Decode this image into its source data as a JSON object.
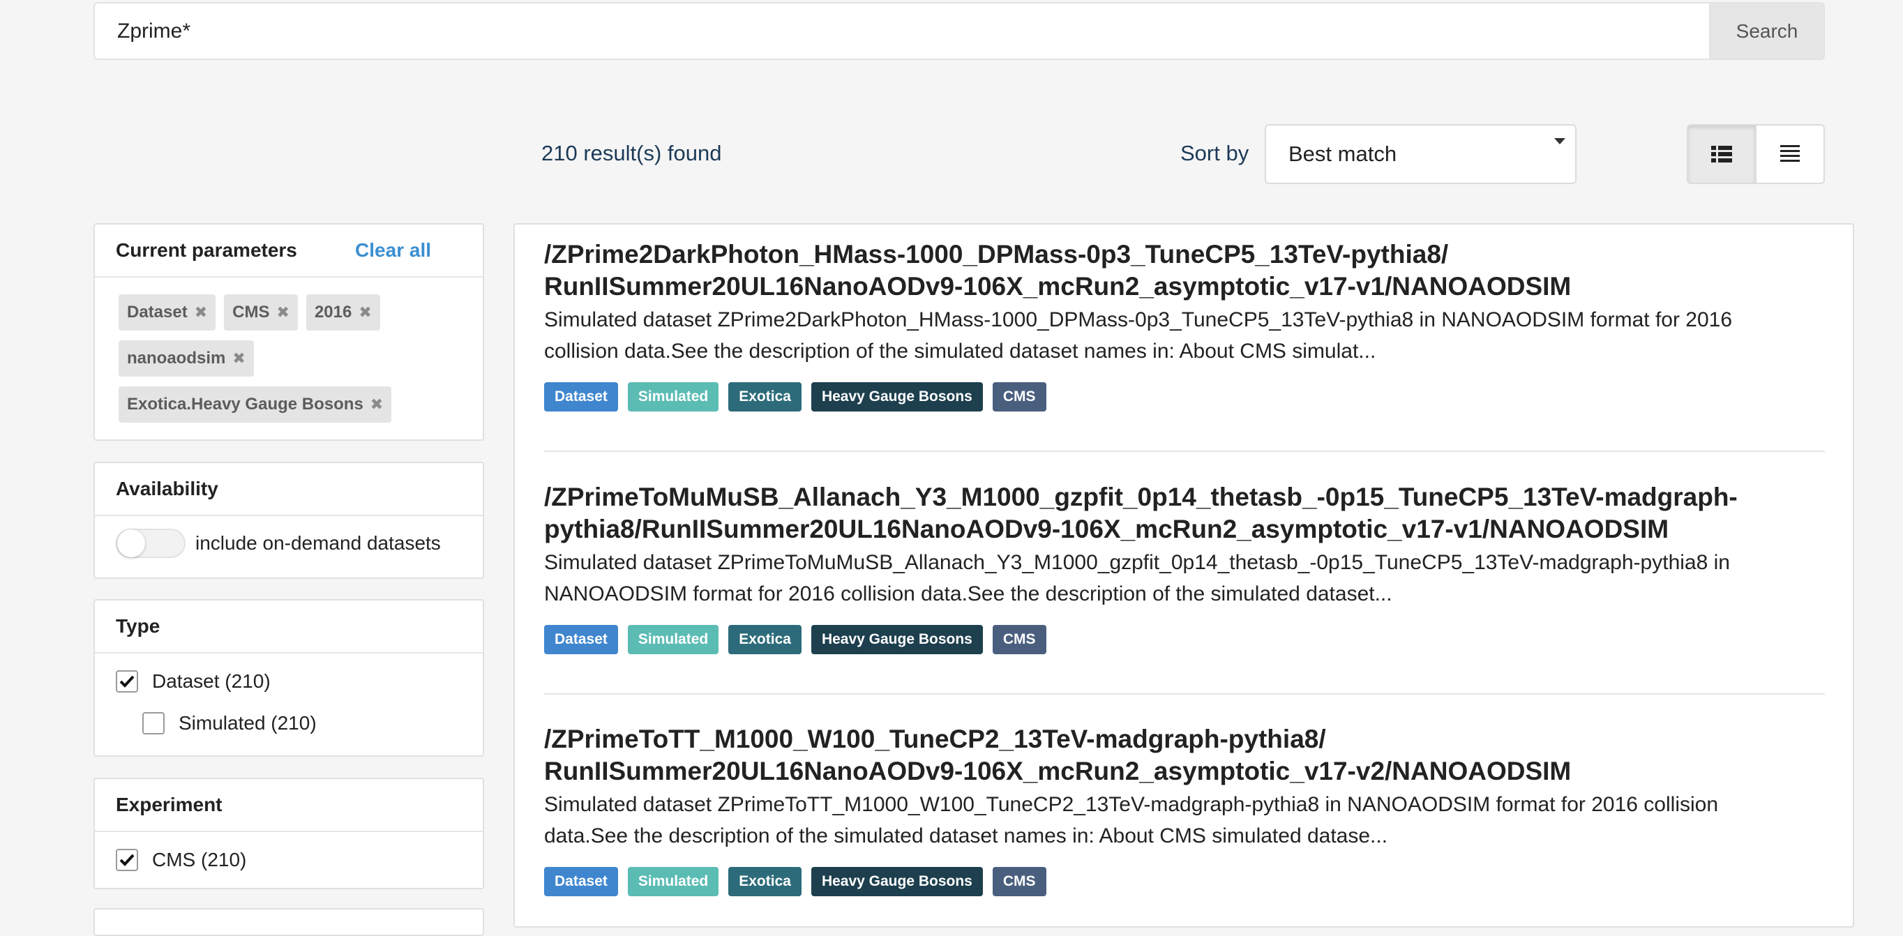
{
  "search": {
    "value": "Zprime*",
    "button_label": "Search"
  },
  "toolbar": {
    "results_count": "210 result(s) found",
    "sort_label": "Sort by",
    "sort_selected": "Best match",
    "view_icons": [
      "list-view-icon",
      "detailed-list-icon"
    ]
  },
  "sidebar": {
    "current_parameters": {
      "title": "Current parameters",
      "clear_label": "Clear all",
      "chips": [
        "Dataset",
        "CMS",
        "2016",
        "nanoaodsim",
        "Exotica.Heavy Gauge Bosons"
      ]
    },
    "availability": {
      "title": "Availability",
      "toggle_label": "include on-demand datasets",
      "toggle_on": false
    },
    "type": {
      "title": "Type",
      "options": [
        {
          "label": "Dataset (210)",
          "checked": true
        },
        {
          "label": "Simulated (210)",
          "checked": false
        }
      ]
    },
    "experiment": {
      "title": "Experiment",
      "options": [
        {
          "label": "CMS (210)",
          "checked": true
        }
      ]
    }
  },
  "results": [
    {
      "title_line1": "/ZPrime2DarkPhoton_HMass-1000_DPMass-0p3_TuneCP5_13TeV-pythia8/",
      "title_line2": "RunIISummer20UL16NanoAODv9-106X_mcRun2_asymptotic_v17-v1/NANOAODSIM",
      "desc_line1": "Simulated dataset ZPrime2DarkPhoton_HMass-1000_DPMass-0p3_TuneCP5_13TeV-pythia8 in NANOAODSIM format for 2016",
      "desc_line2": "collision data.See the description of the simulated dataset names in: About CMS simulat...",
      "badges": [
        "Dataset",
        "Simulated",
        "Exotica",
        "Heavy Gauge Bosons",
        "CMS"
      ]
    },
    {
      "title_line1": "/ZPrimeToMuMuSB_Allanach_Y3_M1000_gzpfit_0p14_thetasb_-0p15_TuneCP5_13TeV-madgraph-",
      "title_line2": "pythia8/RunIISummer20UL16NanoAODv9-106X_mcRun2_asymptotic_v17-v1/NANOAODSIM",
      "desc_line1": "Simulated dataset ZPrimeToMuMuSB_Allanach_Y3_M1000_gzpfit_0p14_thetasb_-0p15_TuneCP5_13TeV-madgraph-pythia8 in",
      "desc_line2": "NANOAODSIM format for 2016 collision data.See the description of the simulated dataset...",
      "badges": [
        "Dataset",
        "Simulated",
        "Exotica",
        "Heavy Gauge Bosons",
        "CMS"
      ]
    },
    {
      "title_line1": "/ZPrimeToTT_M1000_W100_TuneCP2_13TeV-madgraph-pythia8/",
      "title_line2": "RunIISummer20UL16NanoAODv9-106X_mcRun2_asymptotic_v17-v2/NANOAODSIM",
      "desc_line1": "Simulated dataset ZPrimeToTT_M1000_W100_TuneCP2_13TeV-madgraph-pythia8 in NANOAODSIM format for 2016 collision",
      "desc_line2": "data.See the description of the simulated dataset names in: About CMS simulated datase...",
      "badges": [
        "Dataset",
        "Simulated",
        "Exotica",
        "Heavy Gauge Bosons",
        "CMS"
      ]
    }
  ],
  "colors": {
    "badge_dataset": "#3f86cf",
    "badge_simulated": "#5bbcb4",
    "badge_exotica": "#2d6b7a",
    "badge_heavy_gauge_bosons": "#1d3f4e",
    "badge_cms": "#4a5f7e",
    "link": "#3a8fd0",
    "text_dark_blue": "#1b3a57"
  }
}
